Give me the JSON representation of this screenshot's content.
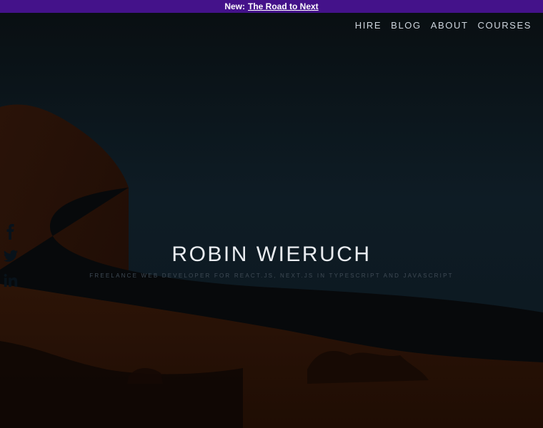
{
  "banner": {
    "prefix": "New:",
    "link_text": "The Road to Next"
  },
  "nav": {
    "items": [
      {
        "label": "HIRE"
      },
      {
        "label": "BLOG"
      },
      {
        "label": "ABOUT"
      },
      {
        "label": "COURSES"
      }
    ]
  },
  "hero": {
    "title": "ROBIN WIERUCH",
    "subtitle": "Freelance Web Developer for React.js, Next.js in TypeScript and JavaScript"
  },
  "social": {
    "icons": [
      "facebook-icon",
      "twitter-icon",
      "linkedin-icon"
    ]
  },
  "colors": {
    "banner_bg": "#44128a",
    "sky_top": "#0a1013",
    "sky_mid": "#0e1b24",
    "dune": "#2a1206"
  }
}
